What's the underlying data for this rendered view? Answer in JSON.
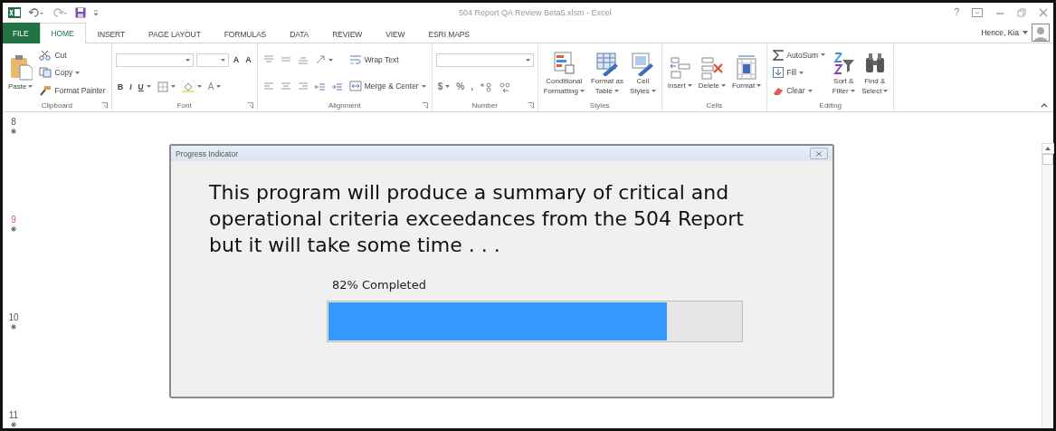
{
  "window": {
    "title": "504 Report QA Review Beta5.xlsm - Excel",
    "help": "?",
    "user": "Hence, Kia"
  },
  "tabs": [
    {
      "label": "FILE",
      "selected": false,
      "kind": "file"
    },
    {
      "label": "HOME",
      "selected": true,
      "kind": "tab"
    },
    {
      "label": "INSERT",
      "selected": false,
      "kind": "tab"
    },
    {
      "label": "PAGE LAYOUT",
      "selected": false,
      "kind": "tab"
    },
    {
      "label": "FORMULAS",
      "selected": false,
      "kind": "tab"
    },
    {
      "label": "DATA",
      "selected": false,
      "kind": "tab"
    },
    {
      "label": "REVIEW",
      "selected": false,
      "kind": "tab"
    },
    {
      "label": "VIEW",
      "selected": false,
      "kind": "tab"
    },
    {
      "label": "ESRI MAPS",
      "selected": false,
      "kind": "tab"
    }
  ],
  "ribbon": {
    "groups": [
      {
        "name": "Clipboard",
        "launcher": true,
        "columns": [
          [
            [
              {
                "kind": "paste",
                "label": "Paste",
                "dropdown": true
              }
            ]
          ],
          [
            [
              {
                "kind": "cut",
                "label": "Cut"
              }
            ],
            [
              {
                "kind": "copy",
                "label": "Copy",
                "dropdown": true
              }
            ],
            [
              {
                "kind": "painter",
                "label": "Format Painter"
              }
            ]
          ]
        ]
      },
      {
        "name": "Font",
        "launcher": true,
        "columns": [
          [
            [
              {
                "kind": "fontfield",
                "dropdown": true
              },
              {
                "kind": "sizefield",
                "dropdown": true
              },
              {
                "kind": "grow",
                "label": "A"
              },
              {
                "kind": "shrink",
                "label": "A"
              }
            ],
            [
              {
                "kind": "bold",
                "label": "B"
              },
              {
                "kind": "italic",
                "label": "I"
              },
              {
                "kind": "underline",
                "label": "U",
                "dropdown": true
              },
              {
                "kind": "borders",
                "dropdown": true
              },
              {
                "kind": "fill",
                "dropdown": true
              },
              {
                "kind": "fontcolor",
                "label": "A",
                "dropdown": true
              }
            ]
          ]
        ]
      },
      {
        "name": "Alignment",
        "launcher": true,
        "columns": [
          [
            [
              {
                "kind": "aligntop"
              },
              {
                "kind": "alignmid"
              },
              {
                "kind": "alignbottom"
              },
              {
                "kind": "orient",
                "dropdown": true
              }
            ],
            [
              {
                "kind": "alignleft"
              },
              {
                "kind": "aligncenter"
              },
              {
                "kind": "alignright"
              },
              {
                "kind": "outdent"
              },
              {
                "kind": "indent"
              }
            ]
          ],
          [
            [
              {
                "kind": "wrap",
                "label": "Wrap Text"
              }
            ],
            [
              {
                "kind": "merge",
                "label": "Merge & Center",
                "dropdown": true
              }
            ]
          ]
        ]
      },
      {
        "name": "Number",
        "launcher": true,
        "columns": [
          [
            [
              {
                "kind": "numfield",
                "dropdown": true
              }
            ],
            [
              {
                "kind": "text",
                "label": "$",
                "dropdown": true
              },
              {
                "kind": "text",
                "label": "%"
              },
              {
                "kind": "text",
                "label": ","
              },
              {
                "kind": "incdec"
              },
              {
                "kind": "decdec"
              }
            ]
          ]
        ]
      },
      {
        "name": "Styles",
        "launcher": false,
        "columns": [
          [
            [
              {
                "kind": "condfmt",
                "label": "Conditional\nFormatting",
                "dropdown": true
              }
            ]
          ],
          [
            [
              {
                "kind": "table",
                "label": "Format as\nTable",
                "dropdown": true
              }
            ]
          ],
          [
            [
              {
                "kind": "cellstyles",
                "label": "Cell\nStyles",
                "dropdown": true
              }
            ]
          ]
        ]
      },
      {
        "name": "Cells",
        "launcher": false,
        "columns": [
          [
            [
              {
                "kind": "insert",
                "label": "Insert",
                "dropdown": true
              }
            ]
          ],
          [
            [
              {
                "kind": "delete",
                "label": "Delete",
                "dropdown": true
              }
            ]
          ],
          [
            [
              {
                "kind": "format",
                "label": "Format",
                "dropdown": true
              }
            ]
          ]
        ]
      },
      {
        "name": "Editing",
        "launcher": false,
        "columns": [
          [
            [
              {
                "kind": "autosum",
                "label": "AutoSum",
                "dropdown": true
              }
            ],
            [
              {
                "kind": "fillsmall",
                "label": "Fill",
                "dropdown": true
              }
            ],
            [
              {
                "kind": "clear",
                "label": "Clear",
                "dropdown": true
              }
            ]
          ],
          [
            [
              {
                "kind": "sort",
                "label": "Sort &\nFilter",
                "dropdown": true
              }
            ]
          ],
          [
            [
              {
                "kind": "find",
                "label": "Find &\nSelect",
                "dropdown": true
              }
            ]
          ]
        ]
      }
    ]
  },
  "rows": [
    {
      "label": "8",
      "selected": false
    },
    {
      "label": "9",
      "selected": true
    },
    {
      "label": "10",
      "selected": false
    },
    {
      "label": "11",
      "selected": false
    }
  ],
  "dialog": {
    "title": "Progress Indicator",
    "message": "This program will produce a summary of critical and operational criteria exceedances from the 504 Report but it will take some time . . .",
    "status": "82% Completed",
    "level": 0.82
  }
}
